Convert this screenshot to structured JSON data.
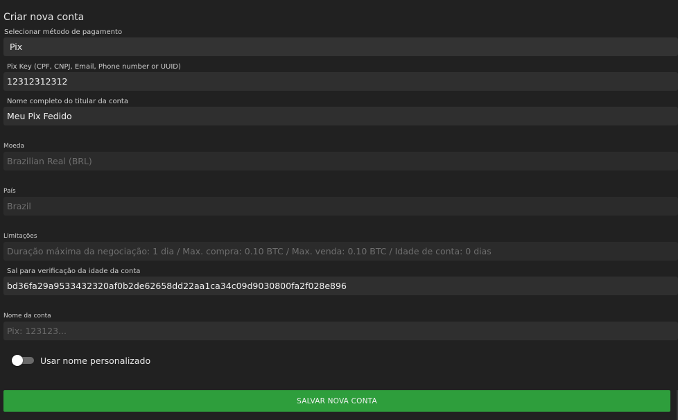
{
  "form": {
    "title": "Criar nova conta",
    "payment_method": {
      "label": "Selecionar método de pagamento",
      "value": "Pix"
    },
    "pix_key": {
      "label": "Pix Key (CPF, CNPJ, Email, Phone number or UUID)",
      "value": "12312312312"
    },
    "holder_name": {
      "label": "Nome completo do titular da conta",
      "value": "Meu Pix Fedido"
    },
    "currency": {
      "label": "Moeda",
      "value": "Brazilian Real (BRL)"
    },
    "country": {
      "label": "País",
      "value": "Brazil"
    },
    "limits": {
      "label": "Limitações",
      "value": "Duração máxima da negociação: 1 dia / Max. compra: 0.10 BTC / Max. venda: 0.10 BTC / Idade de conta: 0 dias"
    },
    "salt": {
      "label": "Sal para verificação da idade da conta",
      "value": "bd36fa29a9533432320af0b2de62658dd22aa1ca34c09d9030800fa2f028e896"
    },
    "account_name": {
      "label": "Nome da conta",
      "value": "",
      "placeholder": "Pix: 123123..."
    },
    "custom_name_toggle": {
      "label": "Usar nome personalizado",
      "checked": false
    },
    "submit_label": "SALVAR NOVA CONTA"
  },
  "colors": {
    "background": "#212121",
    "field": "#333333",
    "field_disabled": "#2b2b2b",
    "accent_green": "#2e9e3c"
  }
}
